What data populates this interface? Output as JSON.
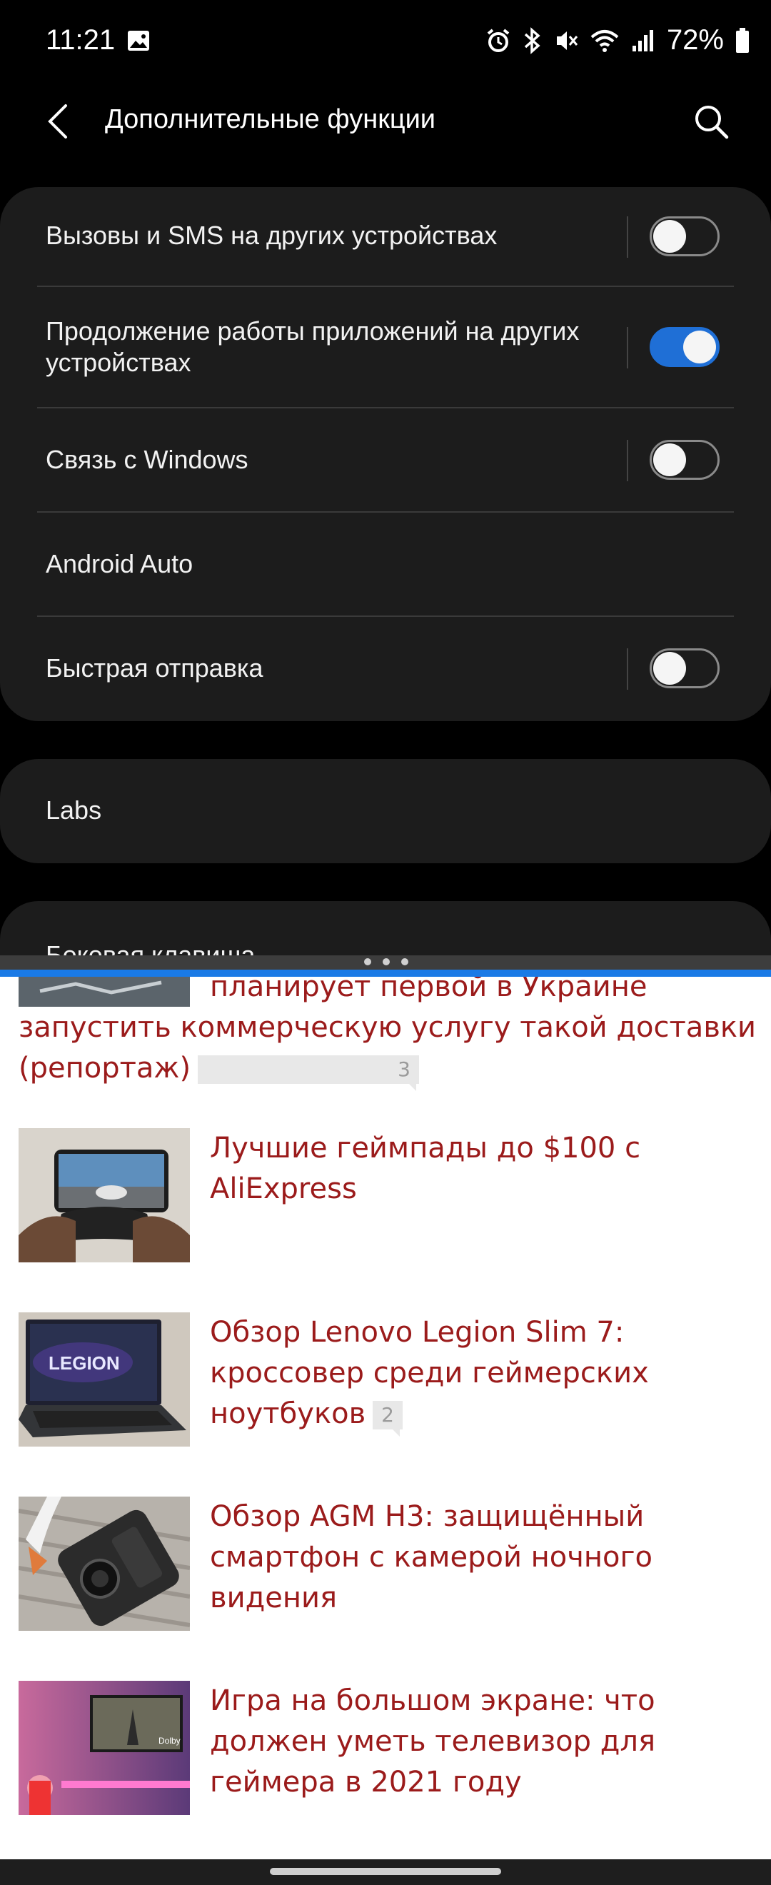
{
  "status_bar": {
    "time": "11:21",
    "battery": "72%",
    "icons": [
      "image-icon",
      "alarm-icon",
      "bluetooth-icon",
      "mute-icon",
      "wifi-icon",
      "signal-icon",
      "battery-icon"
    ]
  },
  "header": {
    "title": "Дополнительные функции",
    "back_icon": "back-arrow-icon",
    "search_icon": "search-icon"
  },
  "settings": {
    "items": [
      {
        "label": "Вызовы и SMS на других устройствах",
        "toggle": false
      },
      {
        "label": "Продолжение работы приложений на других устройствах",
        "toggle": true
      },
      {
        "label": "Связь с Windows",
        "toggle": false
      },
      {
        "label": "Android Auto"
      },
      {
        "label": "Быстрая отправка",
        "toggle": false
      }
    ],
    "labs": "Labs",
    "side_key": "Боковая клавиша"
  },
  "browser": {
    "partial_title": "планирует первой в Украине запустить коммерческую услугу такой доставки (репортаж)",
    "partial_comments": "3",
    "articles": [
      {
        "title": "Лучшие геймпады до $100 с AliExpress",
        "comments": null
      },
      {
        "title": "Обзор Lenovo Legion Slim 7: кроссовер среди геймерских ноутбуков",
        "comments": "2"
      },
      {
        "title": "Обзор AGM H3: защищённый смартфон с камерой ночного видения",
        "comments": null
      },
      {
        "title": "Игра на большом экране: что должен уметь телевизор для геймера в 2021 году",
        "comments": null
      }
    ],
    "thumb_text": {
      "legion": "LEGION",
      "dolby": "Dolby"
    }
  },
  "colors": {
    "toggle_on": "#1f6fd6",
    "card_bg": "#1c1c1c",
    "link": "#9b1b1b",
    "split_accent": "#1a7ae6"
  }
}
